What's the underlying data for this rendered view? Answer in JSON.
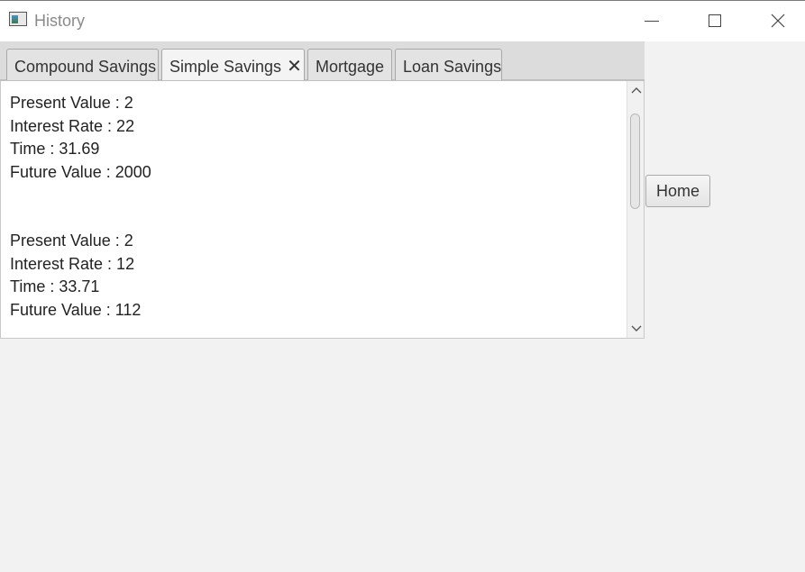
{
  "window": {
    "title": "History"
  },
  "tabs": [
    {
      "label": "Compound Savings",
      "selected": false,
      "closable": false
    },
    {
      "label": "Simple Savings",
      "selected": true,
      "closable": true
    },
    {
      "label": "Mortgage",
      "selected": false,
      "closable": false
    },
    {
      "label": "Loan Savings",
      "selected": false,
      "closable": false
    }
  ],
  "history": [
    {
      "present_value": "Present Value : 2",
      "interest_rate": "Interest Rate : 22",
      "time": "Time : 31.69",
      "future_value": "Future Value : 2000"
    },
    {
      "present_value": "Present Value : 2",
      "interest_rate": "Interest Rate : 12",
      "time": "Time : 33.71",
      "future_value": "Future Value : 112"
    }
  ],
  "buttons": {
    "home_label": "Home"
  },
  "icons": {
    "tab_close": "close-icon",
    "minimize": "minimize-icon",
    "maximize": "maximize-icon",
    "close": "close-icon",
    "scroll_up": "chevron-up-icon",
    "scroll_down": "chevron-down-icon"
  }
}
